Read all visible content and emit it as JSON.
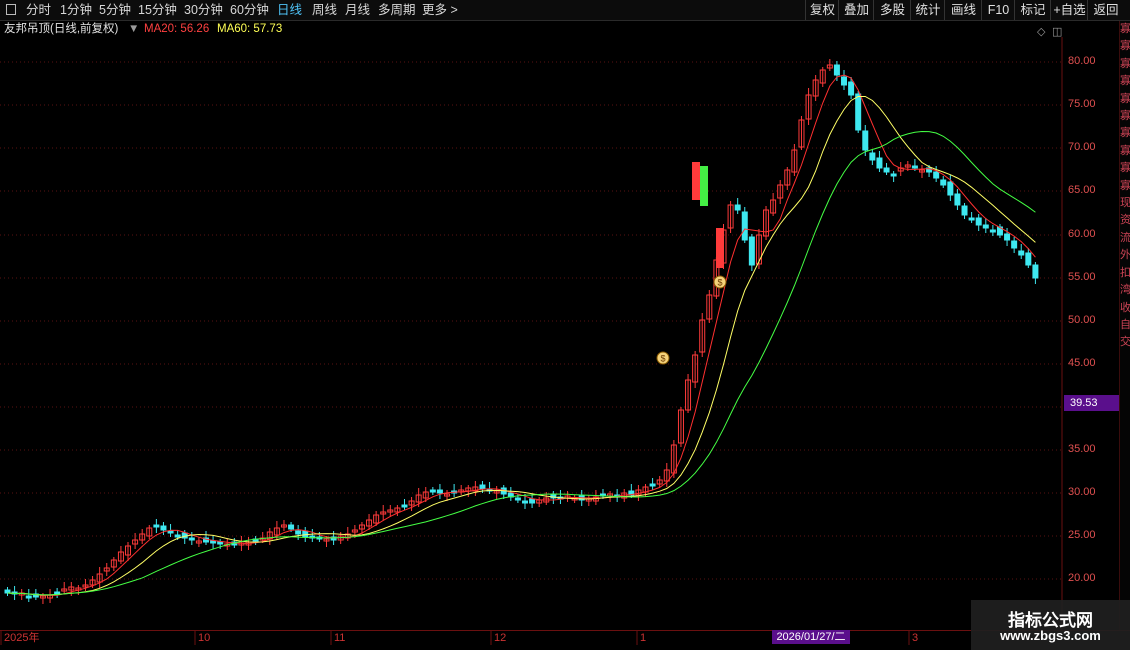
{
  "toolbar": {
    "periods": [
      "分时",
      "1分钟",
      "5分钟",
      "15分钟",
      "30分钟",
      "60分钟",
      "日线",
      "周线",
      "月线",
      "多周期",
      "更多 >"
    ],
    "active_period": "日线",
    "buttons": [
      "复权",
      "叠加",
      "多股",
      "统计",
      "画线",
      "F10",
      "标记",
      "+自选",
      "返回"
    ]
  },
  "info": {
    "stock_title": "友邦吊顶(日线,前复权)",
    "ma20_label": "MA20: 56.26",
    "ma60_label": "MA60: 57.73"
  },
  "price_tag": "39.53",
  "cursor_date": "2026/01/27/二",
  "right_strip": [
    "寡",
    "寡",
    "寡",
    "寡",
    "寡",
    "寡",
    "寡",
    "寡",
    "寡",
    "寡",
    "现",
    "资",
    "流",
    "外",
    "扣",
    "湾",
    "收",
    "自",
    "交"
  ],
  "watermark": {
    "line1": "指标公式网",
    "line2": "www.zbgs3.com"
  },
  "colors": {
    "up": "#ff3b3b",
    "down": "#3ee8f0",
    "ma_short": "#ffff66",
    "ma_long": "#44ff44",
    "ma_red": "#ff3030",
    "highlight_green": "#44ee44",
    "price_tag_bg": "#5a0f8c"
  },
  "chart_data": {
    "type": "candlestick",
    "upper_axis_ticks": [
      "80.00",
      "75.00",
      "70.00",
      "65.00",
      "60.00",
      "55.00",
      "50.00",
      "45.00"
    ],
    "lower_axis_ticks": [
      "35.00",
      "30.00",
      "25.00",
      "20.00"
    ],
    "x_labels": [
      "2025年",
      "10",
      "11",
      "12",
      "1",
      "3"
    ],
    "overlays": [
      "MA20",
      "MA60"
    ],
    "markers": [
      "money-bag-icon",
      "money-bag-icon"
    ],
    "note_values": [
      "MA20: 56.26",
      "MA60: 57.73"
    ]
  }
}
